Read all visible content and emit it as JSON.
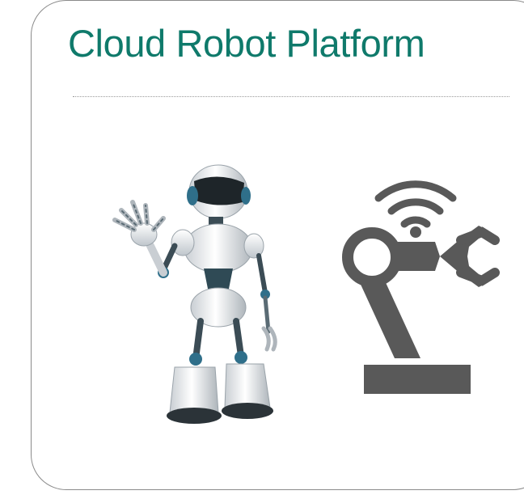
{
  "slide": {
    "title": "Cloud Robot Platform"
  },
  "images": {
    "humanoid_robot": "waving-humanoid-robot-illustration",
    "robot_arm": "wireless-robot-arm-icon"
  },
  "colors": {
    "title": "#0f7a6b",
    "border": "#8a8a8a",
    "arm_icon": "#595959",
    "robot_body": "#e6e9ec",
    "robot_joint": "#2f4a55"
  }
}
